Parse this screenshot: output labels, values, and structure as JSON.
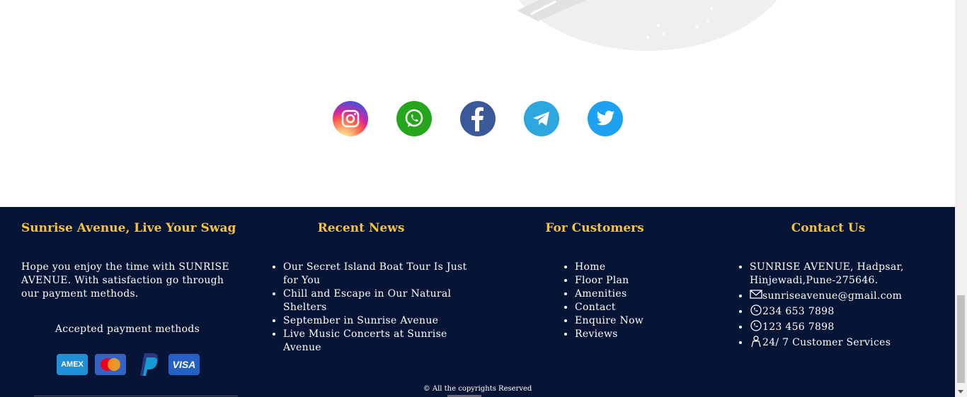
{
  "social": [
    {
      "name": "instagram-icon"
    },
    {
      "name": "whatsapp-icon"
    },
    {
      "name": "facebook-icon"
    },
    {
      "name": "telegram-icon"
    },
    {
      "name": "twitter-icon"
    }
  ],
  "footer": {
    "about": {
      "title": "Sunrise Avenue, Live Your Swag",
      "text": "Hope you enjoy the time with SUNRISE AVENUE. With satisfaction go through our payment methods.",
      "accepted_label": "Accepted payment methods",
      "payment_methods": [
        "AMEX",
        "mastercard",
        "paypal",
        "VISA"
      ]
    },
    "news": {
      "title": "Recent News",
      "items": [
        "Our Secret Island Boat Tour Is Just for You",
        "Chill and Escape in Our Natural Shelters",
        "September in Sunrise Avenue",
        "Live Music Concerts at Sunrise Avenue"
      ]
    },
    "customers": {
      "title": "For Customers",
      "items": [
        "Home",
        "Floor Plan",
        "Amenities",
        "Contact",
        "Enquire Now",
        "Reviews"
      ]
    },
    "contact": {
      "title": "Contact Us",
      "address": "SUNRISE AVENUE, Hadpsar, Hinjewadi,Pune-275646.",
      "email": "sunriseavenue@gmail.com",
      "phone1": "234 653 7898",
      "phone2": "123 456 7898",
      "service": "24/ 7 Customer Services"
    },
    "copyright": "© All the copyrights Reserved"
  },
  "colors": {
    "footer_bg": "#061536",
    "heading": "#f5c33b"
  }
}
